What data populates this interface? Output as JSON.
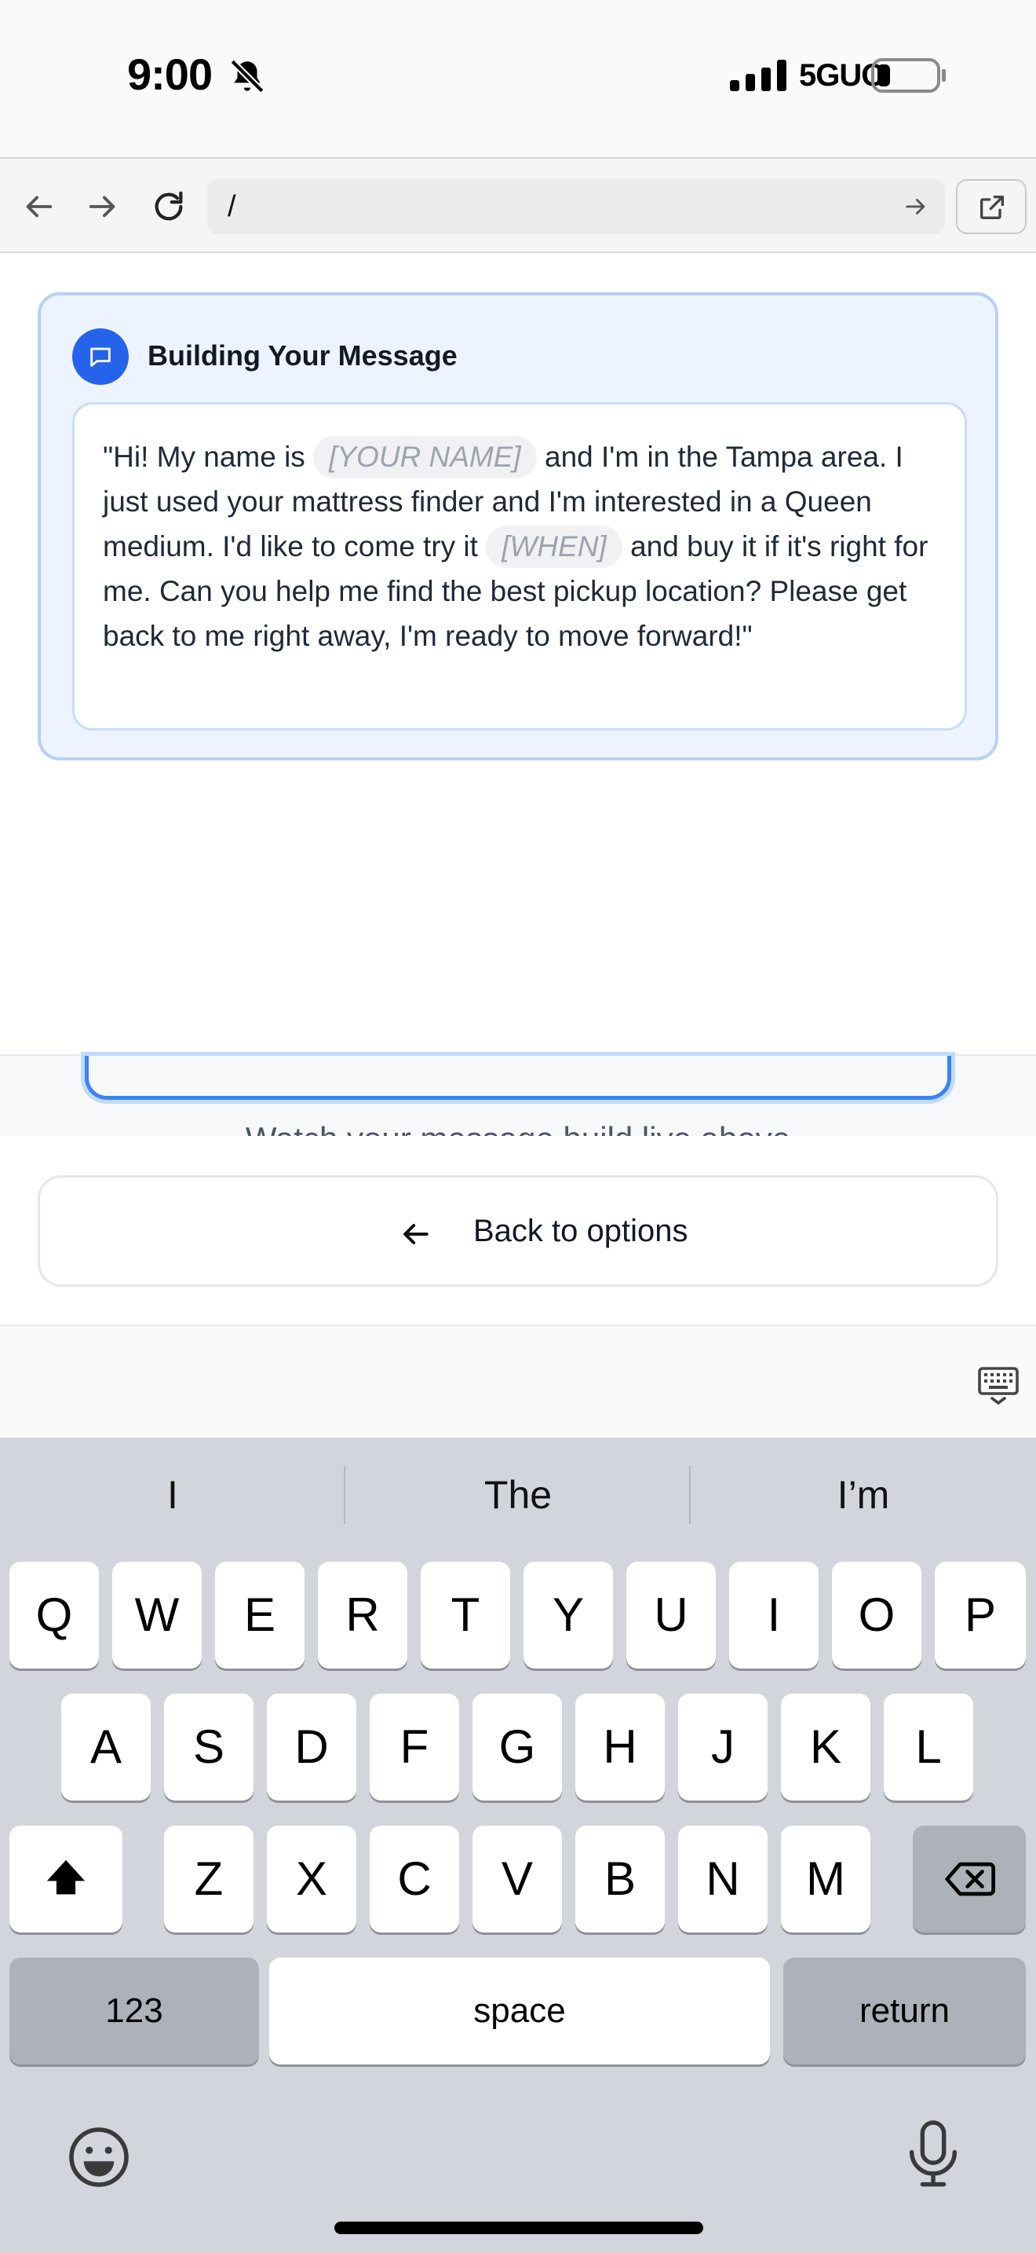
{
  "status_bar": {
    "time": "9:00",
    "network": "5GUC"
  },
  "browser": {
    "url": "/"
  },
  "message_card": {
    "title": "Building Your Message",
    "text_1": "\"Hi! My name is ",
    "placeholder_name": "[YOUR NAME]",
    "text_2": " and I'm in the Tampa area. I just used your mattress finder and I'm interested in a Queen medium. I'd like to come try it ",
    "placeholder_when": "[WHEN]",
    "text_3": " and buy it if it's right for me. Can you help me find the best pickup location? Please get back to me right away, I'm ready to move forward!\""
  },
  "hint": "Watch your message build live above",
  "back_button": {
    "label": "Back to options"
  },
  "keyboard": {
    "suggestions": [
      "I",
      "The",
      "I’m"
    ],
    "row1": [
      "Q",
      "W",
      "E",
      "R",
      "T",
      "Y",
      "U",
      "I",
      "O",
      "P"
    ],
    "row2": [
      "A",
      "S",
      "D",
      "F",
      "G",
      "H",
      "J",
      "K",
      "L"
    ],
    "row3": [
      "Z",
      "X",
      "C",
      "V",
      "B",
      "N",
      "M"
    ],
    "numbers_label": "123",
    "space_label": "space",
    "return_label": "return"
  }
}
